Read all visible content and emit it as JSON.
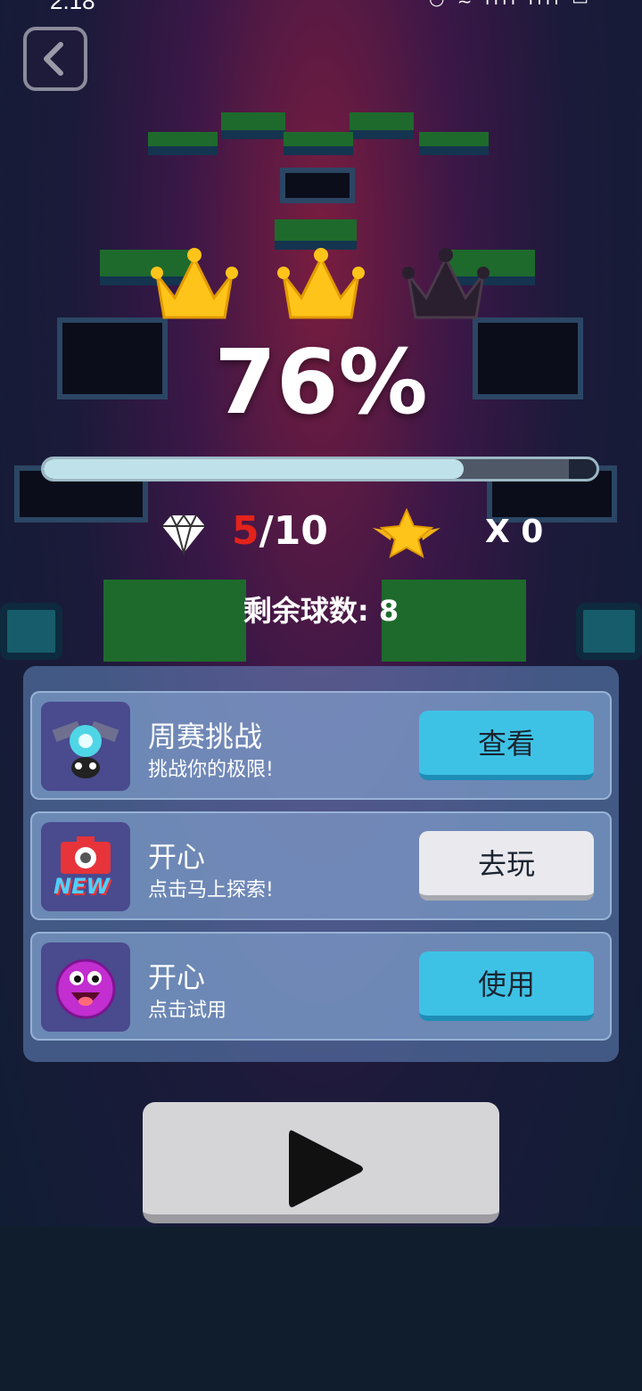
{
  "status_bar": {
    "time": "2:18",
    "icons": "◔ ≋ ıııl ıııl ▭"
  },
  "back_button": {
    "icon": "back-chevron-icon"
  },
  "crowns": {
    "earned": 2,
    "total": 3,
    "earned_color": "#ffc41a",
    "empty_color": "#2a1f2e"
  },
  "progress": {
    "percent_text": "76%",
    "value": 0.76
  },
  "stats": {
    "gems_current": "5",
    "gems_total": "/10",
    "stars_text": "X 0",
    "gem_icon": "diamond-icon",
    "star_icon": "winged-star-icon"
  },
  "balls_remaining": "剩余球数: 8",
  "cards": [
    {
      "title": "周赛挑战",
      "subtitle": "挑战你的极限!",
      "button": "查看",
      "icon": "robot-character-icon",
      "button_style": "blue"
    },
    {
      "title": "开心",
      "subtitle": "点击马上探索!",
      "button": "去玩",
      "icon": "camera-new-icon",
      "button_style": "gray",
      "icon_badge": "NEW"
    },
    {
      "title": "开心",
      "subtitle": "点击试用",
      "button": "使用",
      "icon": "purple-smiley-ball-icon",
      "button_style": "blue"
    }
  ],
  "play_button": {
    "icon": "play-icon"
  },
  "colors": {
    "accent_blue": "#3dc2e6",
    "gem_red": "#e3231b",
    "progress_fill": "#bfe1ea"
  }
}
